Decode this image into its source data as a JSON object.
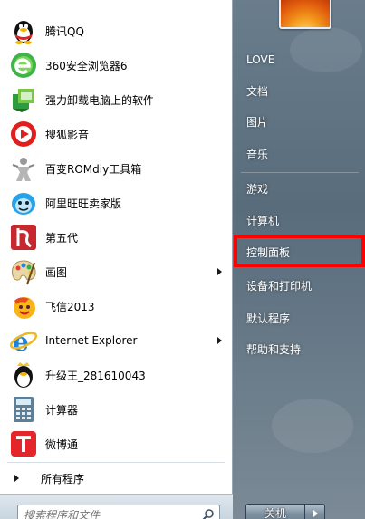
{
  "programs": [
    {
      "label": "腾讯QQ",
      "icon": "qq-penguin-icon",
      "submenu": false
    },
    {
      "label": "360安全浏览器6",
      "icon": "360-browser-icon",
      "submenu": false
    },
    {
      "label": "强力卸载电脑上的软件",
      "icon": "uninstaller-icon",
      "submenu": false
    },
    {
      "label": "搜狐影音",
      "icon": "sohu-video-icon",
      "submenu": false
    },
    {
      "label": "百变ROMdiy工具箱",
      "icon": "rom-toolbox-icon",
      "submenu": false
    },
    {
      "label": "阿里旺旺卖家版",
      "icon": "aliwangwang-icon",
      "submenu": false
    },
    {
      "label": "第五代",
      "icon": "diwudai-icon",
      "submenu": false
    },
    {
      "label": "画图",
      "icon": "paint-palette-icon",
      "submenu": true
    },
    {
      "label": "飞信2013",
      "icon": "fetion-icon",
      "submenu": false
    },
    {
      "label": "Internet Explorer",
      "icon": "internet-explorer-icon",
      "submenu": true
    },
    {
      "label": "升级王_281610043",
      "icon": "upgrade-king-icon",
      "submenu": false
    },
    {
      "label": "计算器",
      "icon": "calculator-icon",
      "submenu": false
    },
    {
      "label": "微博通",
      "icon": "weibotong-icon",
      "submenu": false
    }
  ],
  "all_programs_label": "所有程序",
  "search": {
    "placeholder": "搜索程序和文件"
  },
  "places": [
    {
      "label": "LOVE"
    },
    {
      "label": "文档"
    },
    {
      "label": "图片"
    },
    {
      "label": "音乐"
    },
    {
      "label": "游戏"
    },
    {
      "label": "计算机"
    },
    {
      "label": "控制面板",
      "highlighted": true
    },
    {
      "label": "设备和打印机"
    },
    {
      "label": "默认程序"
    },
    {
      "label": "帮助和支持"
    }
  ],
  "shutdown_label": "关机",
  "colors": {
    "highlight": "#ff0000",
    "right_pane_bg": "#6a7d8c"
  }
}
